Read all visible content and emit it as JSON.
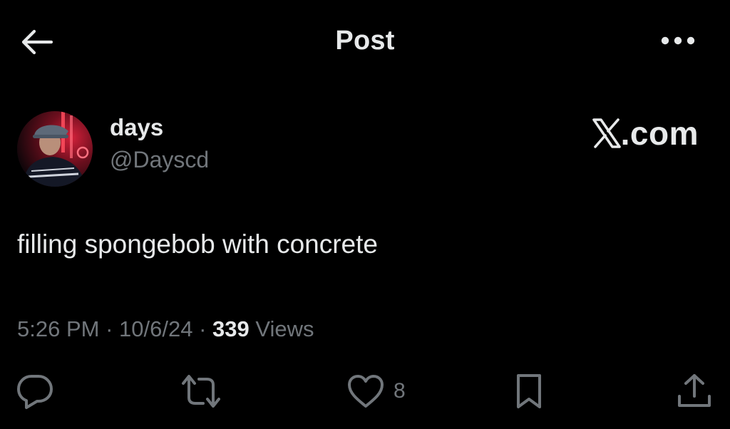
{
  "header": {
    "title": "Post",
    "back_icon": "back-arrow-icon",
    "more_icon": "more-dots-icon"
  },
  "author": {
    "display_name": "days",
    "handle": "@Dayscd"
  },
  "watermark": {
    "text": ".com",
    "logo": "x-logo-icon"
  },
  "post": {
    "text": "filling spongebob with concrete"
  },
  "meta": {
    "time": "5:26 PM",
    "separator": "·",
    "date": "10/6/24",
    "views_count": "339",
    "views_label": "Views"
  },
  "actions": {
    "reply_icon": "reply-icon",
    "repost_icon": "repost-icon",
    "like_icon": "heart-icon",
    "like_count": "8",
    "bookmark_icon": "bookmark-icon",
    "share_icon": "share-icon"
  },
  "colors": {
    "background": "#000000",
    "text_primary": "#e7e9ea",
    "text_secondary": "#71767b"
  }
}
